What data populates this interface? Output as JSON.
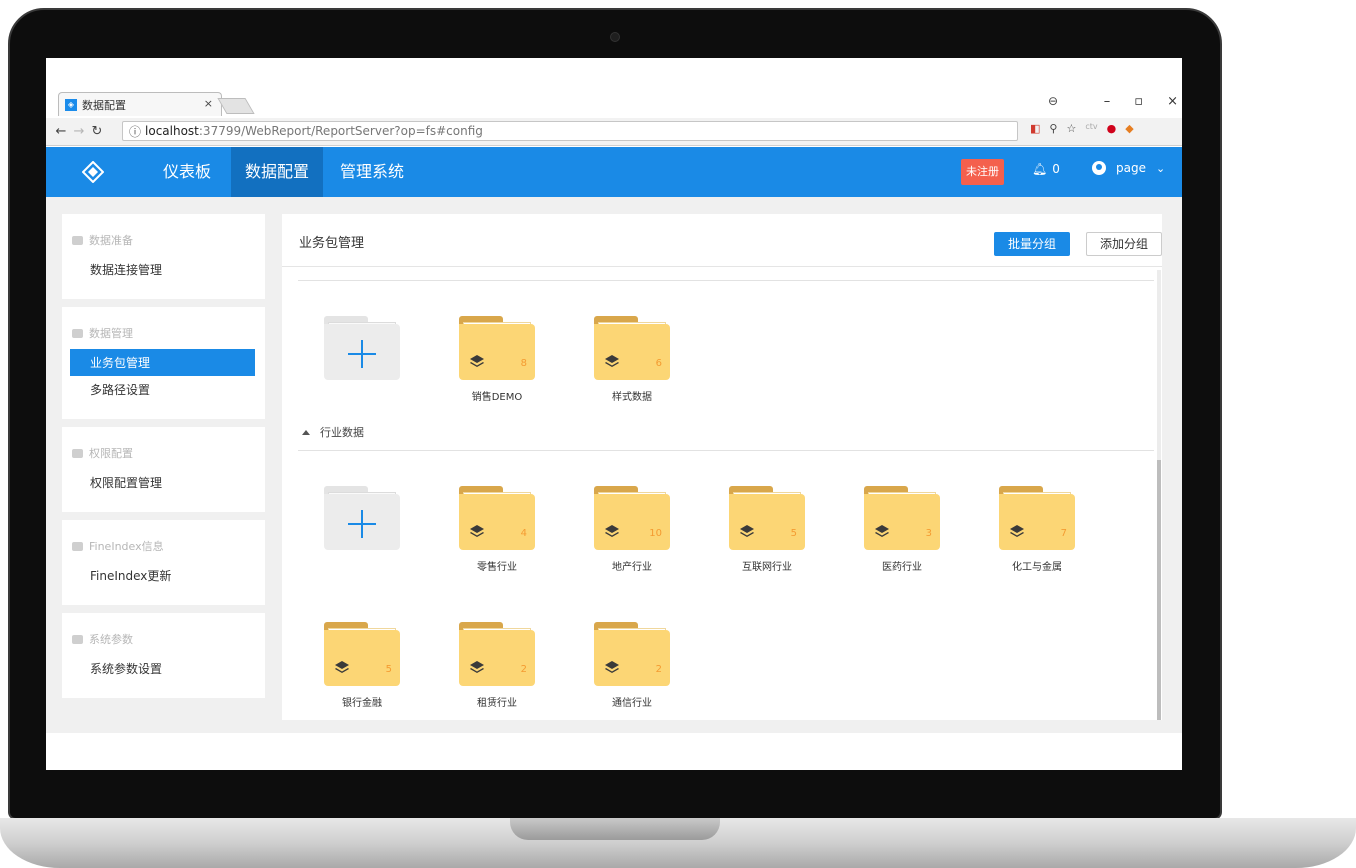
{
  "browser": {
    "tab_title": "数据配置",
    "tab_close": "×",
    "address_host": "localhost",
    "address_path": ":37799/WebReport/ReportServer?op=fs#config",
    "security_glyph": "ⓘ",
    "window_controls": [
      "–",
      "▫",
      "×"
    ]
  },
  "header": {
    "nav": [
      {
        "label": "仪表板"
      },
      {
        "label": "数据配置"
      },
      {
        "label": "管理系统"
      }
    ],
    "unregistered_badge": "未注册",
    "notification_count": "0",
    "username": "page"
  },
  "sidebar": {
    "groups": [
      {
        "title": "数据准备",
        "items": [
          {
            "label": "数据连接管理"
          }
        ]
      },
      {
        "title": "数据管理",
        "items": [
          {
            "label": "业务包管理"
          },
          {
            "label": "多路径设置"
          }
        ]
      },
      {
        "title": "权限配置",
        "items": [
          {
            "label": "权限配置管理"
          }
        ]
      },
      {
        "title": "FineIndex信息",
        "items": [
          {
            "label": "FineIndex更新"
          }
        ]
      },
      {
        "title": "系统参数",
        "items": [
          {
            "label": "系统参数设置"
          }
        ]
      }
    ]
  },
  "content": {
    "title": "业务包管理",
    "batch_group_button": "批量分组",
    "add_group_button": "添加分组",
    "groups": [
      {
        "label": "",
        "packages": [
          {
            "name": "销售DEMO",
            "count": "8"
          },
          {
            "name": "样式数据",
            "count": "6"
          }
        ]
      },
      {
        "label": "行业数据",
        "packages": [
          {
            "name": "零售行业",
            "count": "4"
          },
          {
            "name": "地产行业",
            "count": "10"
          },
          {
            "name": "互联网行业",
            "count": "5"
          },
          {
            "name": "医药行业",
            "count": "3"
          },
          {
            "name": "化工与金属",
            "count": "7"
          },
          {
            "name": "银行金融",
            "count": "5"
          },
          {
            "name": "租赁行业",
            "count": "2"
          },
          {
            "name": "通信行业",
            "count": "2"
          }
        ]
      }
    ]
  },
  "colors": {
    "header_blue": "#1a8ae6",
    "header_active": "#1270c0",
    "badge_red": "#f4604d",
    "folder_yellow": "#fcd675",
    "count_orange": "#f49b31"
  }
}
